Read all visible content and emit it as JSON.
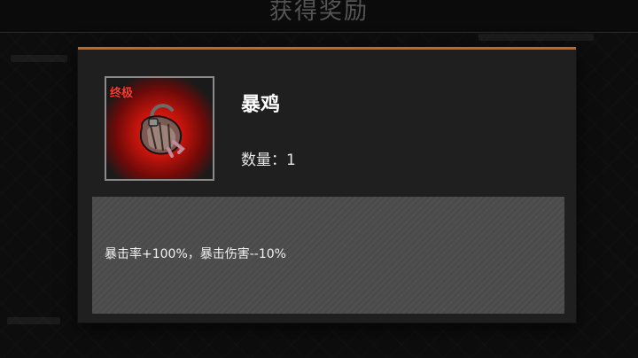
{
  "screen": {
    "title": "获得奖励"
  },
  "item": {
    "rarity": "终极",
    "name": "暴鸡",
    "quantity_label": "数量：",
    "quantity": "1",
    "description": "暴击率+100%，暴击伤害--10%",
    "icon": "chicken-item-icon"
  },
  "colors": {
    "accent": "#c6661c",
    "rarity_red": "#ff3a2a",
    "glow_red": "#ff2a14"
  }
}
